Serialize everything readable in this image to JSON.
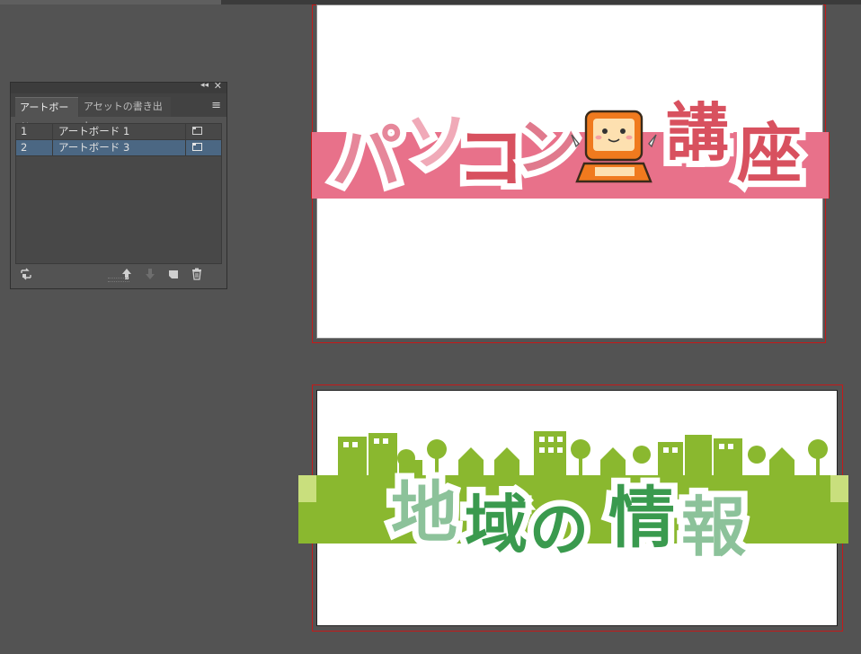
{
  "panel": {
    "tabs": [
      {
        "label": "アートボード",
        "active": true
      },
      {
        "label": "アセットの書き出し",
        "active": false
      }
    ],
    "artboards": [
      {
        "number": "1",
        "name": "アートボード 1",
        "selected": false
      },
      {
        "number": "2",
        "name": "アートボード 3",
        "selected": true
      }
    ]
  },
  "artboard_top": {
    "banner_text": [
      "パ",
      "ソ",
      "コ",
      "ン",
      "講",
      "座"
    ],
    "band_color": "#e8718a",
    "text_color": "#d8515f"
  },
  "artboard_bottom": {
    "banner_text": [
      "地",
      "域",
      "の",
      "情",
      "報"
    ],
    "band_color": "#8ab82f",
    "text_color": "#3a9a4e"
  },
  "colors": {
    "canvas": "#535353",
    "selection": "#4b6783",
    "artboard_border": "#c41a1a"
  }
}
